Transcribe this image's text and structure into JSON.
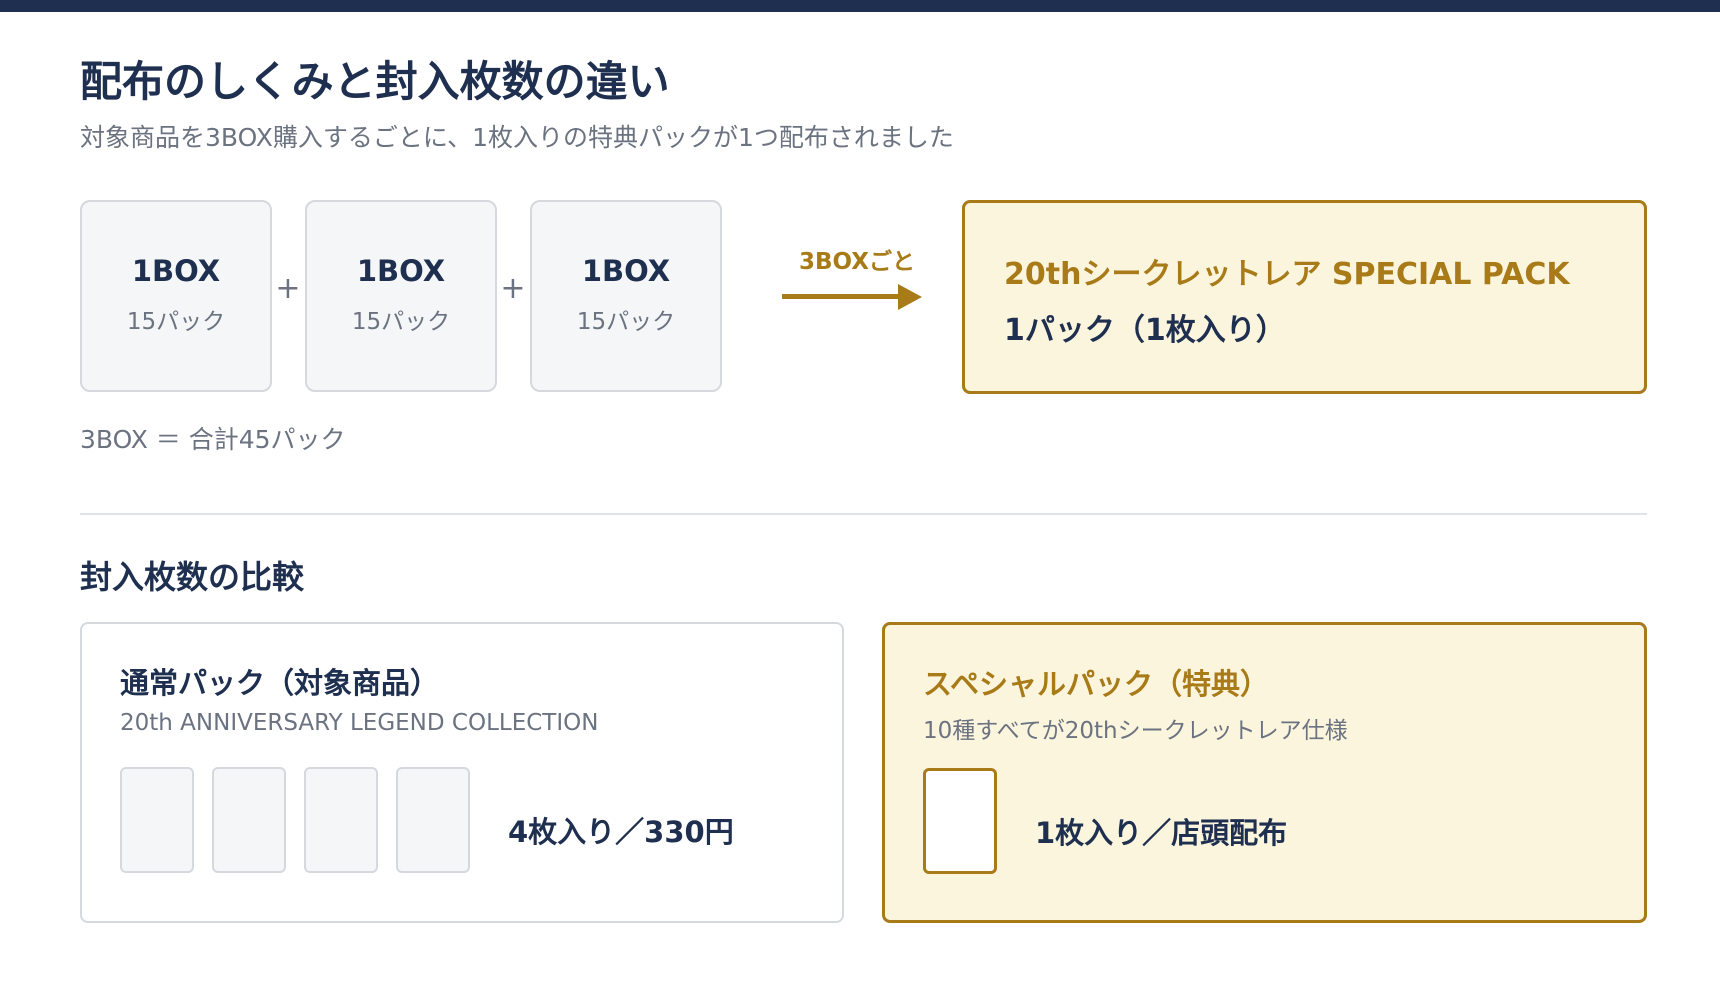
{
  "title": "配布のしくみと封入枚数の違い",
  "subtitle": "対象商品を3BOX購入するごとに、1枚入りの特典パックが1つ配布されました",
  "boxes": [
    {
      "label": "1BOX",
      "packs": "15パック"
    },
    {
      "label": "1BOX",
      "packs": "15パック"
    },
    {
      "label": "1BOX",
      "packs": "15パック"
    }
  ],
  "plus_symbol": "+",
  "total": "3BOX ＝ 合計45パック",
  "arrow_label": "3BOXごと",
  "special_pack": {
    "title": "20thシークレットレア SPECIAL PACK",
    "subtitle": "1パック（1枚入り）"
  },
  "comparison": {
    "heading": "封入枚数の比較",
    "normal": {
      "title": "通常パック（対象商品）",
      "subtitle": "20th ANNIVERSARY LEGEND COLLECTION",
      "card_count": 4,
      "count_text": "4枚入り／330円"
    },
    "special": {
      "title": "スペシャルパック（特典）",
      "subtitle": "10種すべてが20thシークレットレア仕様",
      "card_count": 1,
      "count_text": "1枚入り／店頭配布"
    }
  },
  "colors": {
    "navy": "#1e2f4f",
    "gold": "#a87b18",
    "cream": "#fcf5de",
    "gray_text": "#6b7280",
    "box_fill": "#f4f6f8",
    "box_border": "#d5d9de"
  }
}
